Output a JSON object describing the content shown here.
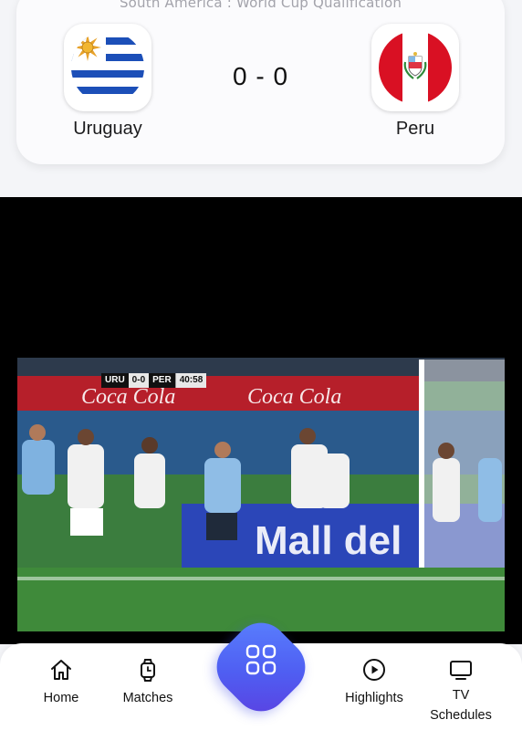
{
  "match": {
    "competition": "South America : World Cup Qualification",
    "home_team": "Uruguay",
    "away_team": "Peru",
    "score": "0 - 0",
    "home_flag_icon": "uruguay-flag",
    "away_flag_icon": "peru-flag"
  },
  "video": {
    "scorebug": {
      "home": "URU",
      "score": "0-0",
      "away": "PER",
      "time": "40:58"
    }
  },
  "nav": {
    "items": [
      {
        "label": "Home",
        "icon": "home-icon"
      },
      {
        "label": "Matches",
        "icon": "watch-icon"
      },
      {
        "label": "",
        "icon": "grid-icon"
      },
      {
        "label": "Highlights",
        "icon": "play-circle-icon"
      },
      {
        "label_line1": "TV",
        "label_line2": "Schedules",
        "icon": "tv-icon"
      }
    ]
  },
  "colors": {
    "accent_gradient_start": "#5a83ff",
    "accent_gradient_end": "#5b3fe0",
    "uruguay_blue": "#1c4fb8",
    "peru_red": "#d91023"
  }
}
